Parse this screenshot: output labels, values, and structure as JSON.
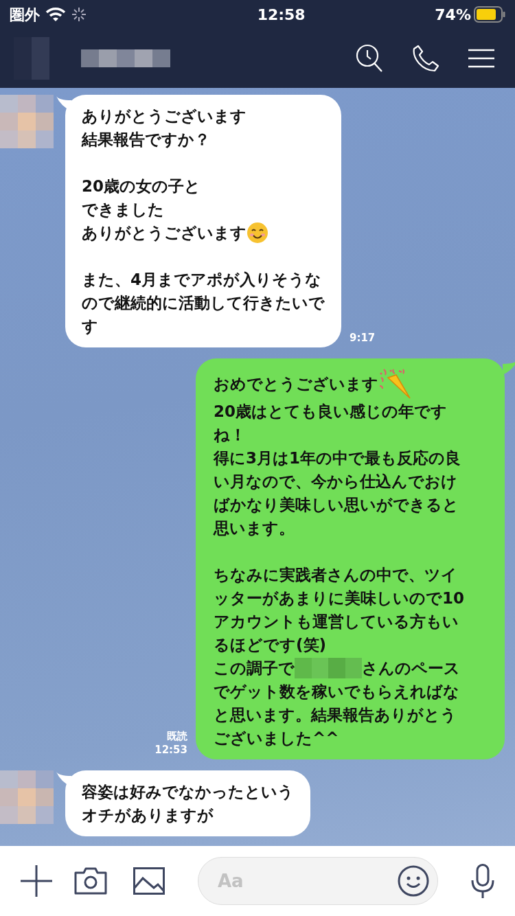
{
  "status_bar": {
    "carrier": "圏外",
    "time": "12:58",
    "battery": "74%"
  },
  "messages": [
    {
      "kind": "incoming",
      "lines": [
        {
          "kind": "text",
          "text": "ありがとうございます"
        },
        {
          "kind": "text",
          "text": "結果報告ですか？"
        },
        {
          "kind": "blank"
        },
        {
          "kind": "text",
          "text": "20歳の女の子と"
        },
        {
          "kind": "text",
          "text": "できました"
        },
        {
          "kind": "icon",
          "text": "ありがとうございます"
        },
        {
          "kind": "blank"
        },
        {
          "kind": "text",
          "text": "また、4月までアポが入りそうな"
        },
        {
          "kind": "text",
          "text": "ので継続的に活動して行きたいで"
        },
        {
          "kind": "text",
          "text": "す"
        }
      ],
      "time": "9:17"
    },
    {
      "kind": "outgoing",
      "lines": [
        {
          "kind": "icon",
          "text": "おめでとうございます"
        },
        {
          "kind": "text",
          "text": "20歳はとても良い感じの年です"
        },
        {
          "kind": "text",
          "text": "ね！"
        },
        {
          "kind": "text",
          "text": "得に3月は1年の中で最も反応の良"
        },
        {
          "kind": "text",
          "text": "い月なので、今から仕込んでおけ"
        },
        {
          "kind": "text",
          "text": "ばかなり美味しい思いができると"
        },
        {
          "kind": "text",
          "text": "思います。"
        },
        {
          "kind": "blank"
        },
        {
          "kind": "text",
          "text": "ちなみに実践者さんの中で、ツイ"
        },
        {
          "kind": "text",
          "text": "ッターがあまりに美味しいので10"
        },
        {
          "kind": "text",
          "text": "アカウントも運営している方もい"
        },
        {
          "kind": "text",
          "text": "るほどです(笑)"
        },
        {
          "kind": "redacted",
          "text": "この調子で",
          "after": "さんのペース"
        },
        {
          "kind": "text",
          "text": "でゲット数を稼いでもらえればな"
        },
        {
          "kind": "text",
          "text": "と思います。結果報告ありがとう"
        },
        {
          "kind": "text",
          "text": "ございました^^"
        }
      ],
      "read": "既読",
      "time": "12:53"
    },
    {
      "kind": "incoming",
      "lines": [
        {
          "kind": "text",
          "text": "容姿は好みでなかったという"
        },
        {
          "kind": "text",
          "text": "オチがありますが"
        }
      ]
    }
  ],
  "composer": {
    "placeholder": "Aa"
  }
}
